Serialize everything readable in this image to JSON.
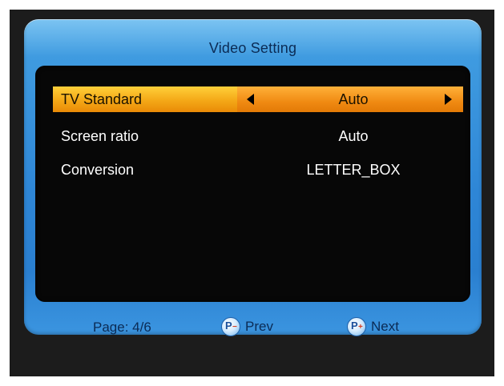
{
  "dialog": {
    "title": "Video Setting"
  },
  "settings": [
    {
      "label": "TV Standard",
      "value": "Auto",
      "selected": true
    },
    {
      "label": "Screen ratio",
      "value": "Auto",
      "selected": false
    },
    {
      "label": "Conversion",
      "value": "LETTER_BOX",
      "selected": false
    }
  ],
  "footer": {
    "page": "Page: 4/6",
    "prev_label": "Prev",
    "next_label": "Next",
    "prev_icon_letter": "P",
    "prev_icon_sign": "−",
    "next_icon_letter": "P",
    "next_icon_sign": "+"
  },
  "colors": {
    "panel_blue": "#2e86d6",
    "selected_highlight": "#f4a817",
    "content_background": "#070707"
  }
}
